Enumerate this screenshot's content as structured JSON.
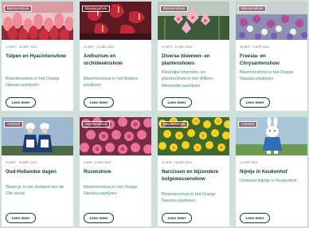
{
  "cards": [
    {
      "badge": "Bloemenshow",
      "date": "21 MRT - 26 MRT 2024",
      "title": "Tulpen en Hyacintenshow",
      "desc": "Bloemenshow in het Oranje Nassau paviljoen",
      "button": "Lees meer",
      "image": "tulips-icon"
    },
    {
      "badge": "Bloemenshow",
      "date": "21 MRT - 12 MEI 2024",
      "title": "Anthurium en orchideeënshow",
      "desc": "Bloemenshow in het Beatrix paviljoen",
      "button": "Lees meer",
      "image": "orchid-icon"
    },
    {
      "badge": "Bloemenshow",
      "date": "21 MRT - 12 MEI 2024",
      "title": "Diverse bloemen- en plantenshows",
      "desc": "Kleurrijke bloemen- en plantenshow in het Willem-Alexander paviljoen",
      "button": "Lees meer",
      "image": "lily-icon"
    },
    {
      "badge": "Bloemenshow",
      "date": "28 MRT - 2 APR 2024",
      "title": "Freesia- en Chrysantenshow",
      "desc": "Bloemenshow in het Oranje Nassau paviljoen",
      "button": "Lees meer",
      "image": "freesia-icon"
    },
    {
      "badge": "Activiteit",
      "date": "29 MRT - 30 MRT 2024",
      "title": "Oud-Hollandse dagen",
      "desc": "Waan je in het Holland van de 19e eeuw",
      "button": "Lees meer",
      "image": "dutch-costume-icon"
    },
    {
      "badge": "Bloemenshow",
      "date": "4 APR - 9 APR 2024",
      "title": "Rozenshow",
      "desc": "Bloemenshow in het Oranje Nassau paviljoen",
      "button": "Lees meer",
      "image": "roses-icon"
    },
    {
      "badge": "Bloemenshow",
      "date": "11 APR - 16 APR 2024",
      "title": "Narcissen en bijzondere bolgewassenshow",
      "desc": "Bloemenshow in het Oranje Nassau paviljoen",
      "button": "Lees meer",
      "image": "daffodils-icon"
    },
    {
      "badge": "Activiteit",
      "date": "17 APR 2024",
      "title": "Nijntje in Keukenhof",
      "desc": "Ontmoet Nijntje in Keukenhof",
      "button": "Lees meer",
      "image": "miffy-icon"
    }
  ],
  "colors": {
    "background": "#cfe0dc",
    "title": "#0d3b36",
    "description": "#3e8a82",
    "badge_fill": "#6e2337"
  }
}
